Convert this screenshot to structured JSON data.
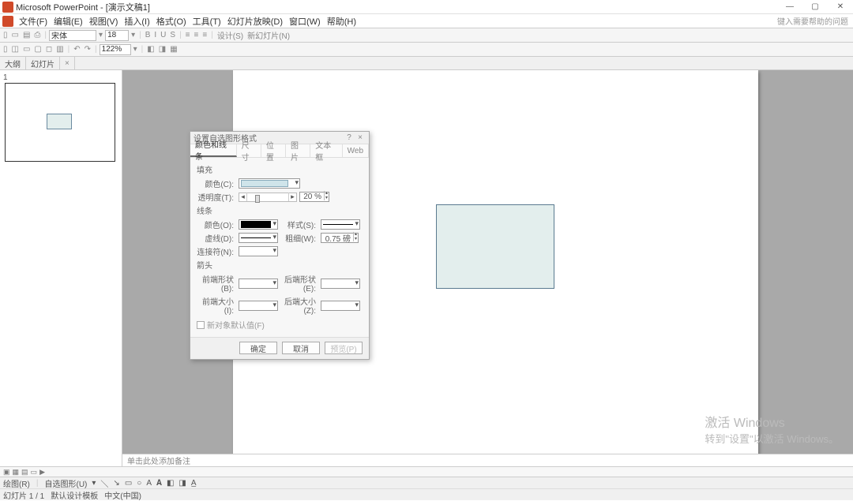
{
  "app": {
    "title": "Microsoft PowerPoint - [演示文稿1]"
  },
  "menu": {
    "file": "文件(F)",
    "edit": "编辑(E)",
    "view": "视图(V)",
    "insert": "插入(I)",
    "format": "格式(O)",
    "tools": "工具(T)",
    "slideshow": "幻灯片放映(D)",
    "window": "窗口(W)",
    "help": "帮助(H)",
    "ask": "键入需要帮助的问题"
  },
  "toolbar": {
    "font": "宋体",
    "fontsize": "18",
    "zoom": "122%",
    "design": "设计(S)",
    "newslide": "新幻灯片(N)"
  },
  "docTabs": {
    "tab1": "大纲",
    "tab2": "幻灯片",
    "close": "×"
  },
  "thumb": {
    "num": "1"
  },
  "notes": {
    "placeholder": "单击此处添加备注"
  },
  "watermark": {
    "l1": "激活 Windows",
    "l2": "转到\"设置\"以激活 Windows。"
  },
  "dialog": {
    "title": "设置自选图形格式",
    "tabs": {
      "t1": "颜色和线条",
      "t2": "尺寸",
      "t3": "位置",
      "t4": "图片",
      "t5": "文本框",
      "t6": "Web"
    },
    "fill": {
      "hdr": "填充",
      "color": "颜色(C):",
      "trans": "透明度(T):",
      "trans_val": "20 %"
    },
    "line": {
      "hdr": "线条",
      "color": "颜色(O):",
      "style": "样式(S):",
      "dash": "虚线(D):",
      "weight": "粗细(W):",
      "weight_val": "0.75 磅",
      "conn": "连接符(N):"
    },
    "arrow": {
      "hdr": "箭头",
      "fs": "前端形状(B):",
      "es": "后端形状(E):",
      "fz": "前端大小(I):",
      "ez": "后端大小(Z):"
    },
    "chk": "新对象默认值(F)",
    "btns": {
      "ok": "确定",
      "cancel": "取消",
      "preview": "预览(P)"
    }
  },
  "viewstrip": {
    "items": "□ ▯ ▣ ◫ ◨"
  },
  "status1": {
    "draw": "绘图(R)",
    "auto": "自选图形(U)"
  },
  "status2": {
    "counter": "幻灯片 1 / 1",
    "tmpl": "默认设计模板",
    "lang": "中文(中国)"
  }
}
